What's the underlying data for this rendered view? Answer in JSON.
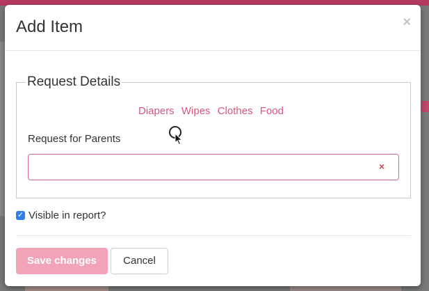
{
  "modal": {
    "title": "Add Item",
    "close_icon": "×"
  },
  "fieldset": {
    "legend": "Request Details",
    "quick_links": [
      "Diapers",
      "Wipes",
      "Clothes",
      "Food"
    ],
    "field_label": "Request for Parents",
    "field_value": "",
    "clear_icon": "×"
  },
  "visible_checkbox": {
    "label": "Visible in report?",
    "checked": true
  },
  "footer": {
    "save_label": "Save changes",
    "cancel_label": "Cancel"
  },
  "colors": {
    "accent": "#d8587a",
    "save_button": "#f3a3b7",
    "checkbox": "#2f7fe6",
    "input_border": "#d46a7e"
  }
}
